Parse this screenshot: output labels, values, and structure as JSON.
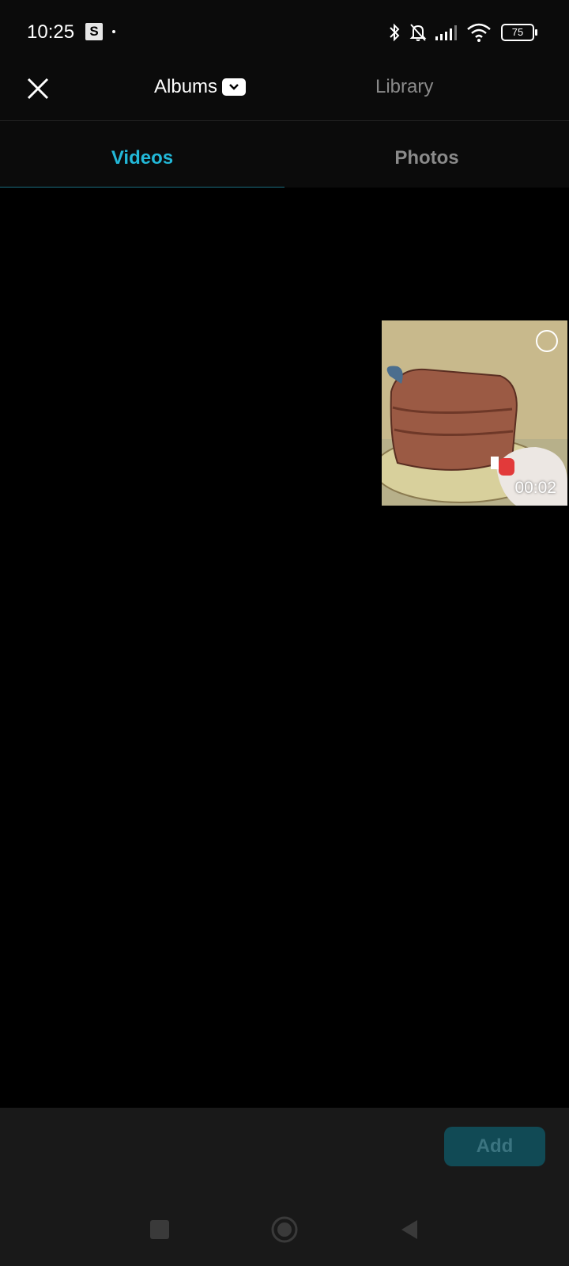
{
  "status_bar": {
    "time": "10:25",
    "app_badge": "S",
    "battery": "75"
  },
  "header": {
    "albums_label": "Albums",
    "library_label": "Library"
  },
  "tabs": [
    {
      "label": "Videos",
      "active": true
    },
    {
      "label": "Photos",
      "active": false
    }
  ],
  "media": [
    {
      "type": "video",
      "duration": "00:02",
      "selected": false
    }
  ],
  "footer": {
    "add_label": "Add"
  },
  "colors": {
    "accent": "#22b8d8",
    "add_button_bg": "#114a55",
    "add_button_text": "#3b7480"
  },
  "icons": [
    "close-icon",
    "chevron-down-icon",
    "bluetooth-icon",
    "muted-bell-icon",
    "signal-icon",
    "wifi-icon",
    "battery-icon"
  ]
}
